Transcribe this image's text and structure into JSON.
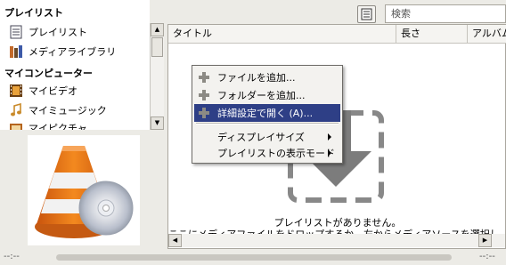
{
  "sidebar": {
    "playlist_header": "プレイリスト",
    "items": [
      {
        "label": "プレイリスト",
        "icon": "playlist-icon"
      },
      {
        "label": "メディアライブラリ",
        "icon": "media-library-icon"
      }
    ],
    "computer_header": "マイコンピューター",
    "computer_items": [
      {
        "label": "マイビデオ",
        "icon": "film-icon"
      },
      {
        "label": "マイミュージック",
        "icon": "music-note-icon"
      },
      {
        "label": "マイピクチャ",
        "icon": "pictures-icon"
      }
    ]
  },
  "search": {
    "placeholder": "検索"
  },
  "playlist": {
    "columns": [
      "タイトル",
      "長さ",
      "アルバム"
    ],
    "empty_title": "プレイリストがありません。",
    "empty_hint": "ここにメディアファイルをドロップするか、左からメディアソースを選択して下さい。"
  },
  "context_menu": {
    "items": [
      {
        "label": "ファイルを追加...",
        "icon": "plus-icon"
      },
      {
        "label": "フォルダーを追加...",
        "icon": "plus-icon"
      },
      {
        "label": "詳細設定で開く (A)...",
        "icon": "plus-icon",
        "selected": true
      }
    ],
    "submenus": [
      {
        "label": "ディスプレイサイズ"
      },
      {
        "label": "プレイリストの表示モード"
      }
    ]
  },
  "playback": {
    "elapsed": "--:--",
    "remaining": "--:--"
  },
  "colors": {
    "menu_highlight": "#2e3f86",
    "window_bg": "#ecebe6",
    "cone_orange": "#e8741a"
  }
}
